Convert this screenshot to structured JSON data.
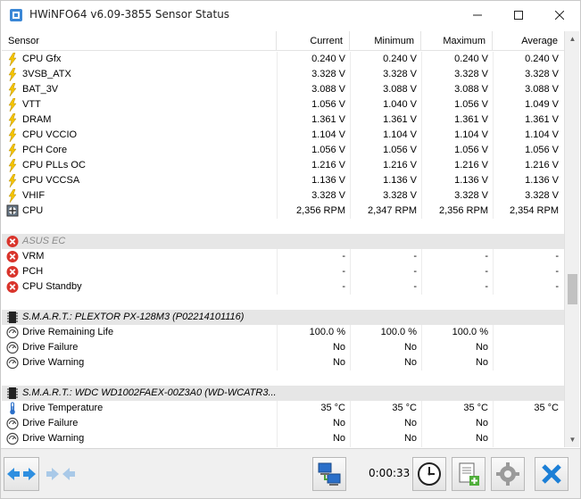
{
  "window": {
    "title": "HWiNFO64 v6.09-3855 Sensor Status"
  },
  "columns": {
    "sensor": "Sensor",
    "current": "Current",
    "minimum": "Minimum",
    "maximum": "Maximum",
    "average": "Average"
  },
  "rows": [
    {
      "type": "sensor",
      "icon": "lightning-icon",
      "label": "CPU Gfx",
      "current": "0.240 V",
      "minimum": "0.240 V",
      "maximum": "0.240 V",
      "average": "0.240 V"
    },
    {
      "type": "sensor",
      "icon": "lightning-icon",
      "label": "3VSB_ATX",
      "current": "3.328 V",
      "minimum": "3.328 V",
      "maximum": "3.328 V",
      "average": "3.328 V"
    },
    {
      "type": "sensor",
      "icon": "lightning-icon",
      "label": "BAT_3V",
      "current": "3.088 V",
      "minimum": "3.088 V",
      "maximum": "3.088 V",
      "average": "3.088 V"
    },
    {
      "type": "sensor",
      "icon": "lightning-icon",
      "label": "VTT",
      "current": "1.056 V",
      "minimum": "1.040 V",
      "maximum": "1.056 V",
      "average": "1.049 V"
    },
    {
      "type": "sensor",
      "icon": "lightning-icon",
      "label": "DRAM",
      "current": "1.361 V",
      "minimum": "1.361 V",
      "maximum": "1.361 V",
      "average": "1.361 V"
    },
    {
      "type": "sensor",
      "icon": "lightning-icon",
      "label": "CPU VCCIO",
      "current": "1.104 V",
      "minimum": "1.104 V",
      "maximum": "1.104 V",
      "average": "1.104 V"
    },
    {
      "type": "sensor",
      "icon": "lightning-icon",
      "label": "PCH Core",
      "current": "1.056 V",
      "minimum": "1.056 V",
      "maximum": "1.056 V",
      "average": "1.056 V"
    },
    {
      "type": "sensor",
      "icon": "lightning-icon",
      "label": "CPU PLLs OC",
      "current": "1.216 V",
      "minimum": "1.216 V",
      "maximum": "1.216 V",
      "average": "1.216 V"
    },
    {
      "type": "sensor",
      "icon": "lightning-icon",
      "label": "CPU VCCSA",
      "current": "1.136 V",
      "minimum": "1.136 V",
      "maximum": "1.136 V",
      "average": "1.136 V"
    },
    {
      "type": "sensor",
      "icon": "lightning-icon",
      "label": "VHIF",
      "current": "3.328 V",
      "minimum": "3.328 V",
      "maximum": "3.328 V",
      "average": "3.328 V"
    },
    {
      "type": "sensor",
      "icon": "fan-icon",
      "label": "CPU",
      "current": "2,356 RPM",
      "minimum": "2,347 RPM",
      "maximum": "2,356 RPM",
      "average": "2,354 RPM"
    },
    {
      "type": "blank"
    },
    {
      "type": "group",
      "disabled": true,
      "icon": "error-icon",
      "label": "ASUS EC"
    },
    {
      "type": "sensor",
      "icon": "error-icon",
      "label": "VRM",
      "current": "-",
      "minimum": "-",
      "maximum": "-",
      "average": "-"
    },
    {
      "type": "sensor",
      "icon": "error-icon",
      "label": "PCH",
      "current": "-",
      "minimum": "-",
      "maximum": "-",
      "average": "-"
    },
    {
      "type": "sensor",
      "icon": "error-icon",
      "label": "CPU Standby",
      "current": "-",
      "minimum": "-",
      "maximum": "-",
      "average": "-"
    },
    {
      "type": "blank"
    },
    {
      "type": "group",
      "icon": "drive-chip-icon",
      "label": "S.M.A.R.T.: PLEXTOR PX-128M3 (P02214101116)"
    },
    {
      "type": "sensor",
      "icon": "gauge-icon",
      "label": "Drive Remaining Life",
      "current": "100.0 %",
      "minimum": "100.0 %",
      "maximum": "100.0 %",
      "average": ""
    },
    {
      "type": "sensor",
      "icon": "gauge-icon",
      "label": "Drive Failure",
      "current": "No",
      "minimum": "No",
      "maximum": "No",
      "average": ""
    },
    {
      "type": "sensor",
      "icon": "gauge-icon",
      "label": "Drive Warning",
      "current": "No",
      "minimum": "No",
      "maximum": "No",
      "average": ""
    },
    {
      "type": "blank"
    },
    {
      "type": "group",
      "icon": "drive-chip-icon",
      "label": "S.M.A.R.T.: WDC WD1002FAEX-00Z3A0 (WD-WCATR3..."
    },
    {
      "type": "sensor",
      "icon": "thermometer-icon",
      "label": "Drive Temperature",
      "current": "35 °C",
      "minimum": "35 °C",
      "maximum": "35 °C",
      "average": "35 °C"
    },
    {
      "type": "sensor",
      "icon": "gauge-icon",
      "label": "Drive Failure",
      "current": "No",
      "minimum": "No",
      "maximum": "No",
      "average": ""
    },
    {
      "type": "sensor",
      "icon": "gauge-icon",
      "label": "Drive Warning",
      "current": "No",
      "minimum": "No",
      "maximum": "No",
      "average": ""
    }
  ],
  "toolbar": {
    "elapsed_time": "0:00:33"
  },
  "colors": {
    "lightning": "#f5c400",
    "error": "#d9342b",
    "close_x": "#1c7fd6",
    "nav_arrow": "#2f8fe0",
    "group_bg": "#e6e6e6"
  }
}
